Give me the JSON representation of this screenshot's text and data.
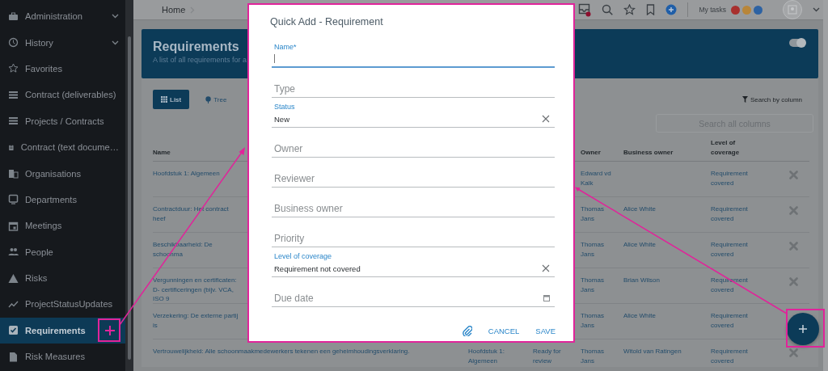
{
  "sidebar": {
    "items": [
      {
        "label": "Administration",
        "expandable": true,
        "selected": false
      },
      {
        "label": "History",
        "expandable": true,
        "selected": false
      },
      {
        "label": "Favorites",
        "expandable": false,
        "selected": false
      },
      {
        "label": "Contract (deliverables)",
        "expandable": false,
        "selected": false
      },
      {
        "label": "Projects / Contracts",
        "expandable": false,
        "selected": false
      },
      {
        "label": "Contract (text docume…",
        "expandable": false,
        "selected": false
      },
      {
        "label": "Organisations",
        "expandable": false,
        "selected": false
      },
      {
        "label": "Departments",
        "expandable": false,
        "selected": false
      },
      {
        "label": "Meetings",
        "expandable": false,
        "selected": false
      },
      {
        "label": "People",
        "expandable": false,
        "selected": false
      },
      {
        "label": "Risks",
        "expandable": false,
        "selected": false
      },
      {
        "label": "ProjectStatusUpdates",
        "expandable": false,
        "selected": false
      },
      {
        "label": "Requirements",
        "expandable": false,
        "selected": true
      },
      {
        "label": "Risk Measures",
        "expandable": false,
        "selected": false
      }
    ]
  },
  "top_bar": {
    "breadcrumb": [
      "Home"
    ],
    "notification": true,
    "tasks_label": "My tasks",
    "task_badges": [
      {
        "color": "#a8302e"
      },
      {
        "color": "#b8863a"
      },
      {
        "color": "#2d62a3"
      }
    ]
  },
  "header": {
    "title": "Requirements",
    "subtitle": "A list of all requirements for a",
    "toggle_on": true
  },
  "views": [
    {
      "label": "List",
      "selected": true
    },
    {
      "label": "Tree",
      "selected": false
    }
  ],
  "search_by_column": "Search by column",
  "search": {
    "placeholder": "Search all columns"
  },
  "table": {
    "columns": [
      "Name",
      "Owner",
      "Business owner",
      "Level of coverage"
    ],
    "rows": [
      {
        "name": "Hoofdstuk 1: Algemeen",
        "owner": "Edward vd Kalk",
        "level_of_coverage": "Requirement covered"
      },
      {
        "name": "Contractduur: Het contract heef",
        "owner": "Thomas Jans",
        "business_owner": "Alice White",
        "level_of_coverage": "Requirement covered"
      },
      {
        "name": "Beschikbaarheid: De schoonma",
        "owner": "Thomas Jans",
        "business_owner": "Alice White",
        "level_of_coverage": "Requirement covered"
      },
      {
        "name": "Vergunningen en certificaten: D- certificeringen (bijv. VCA, ISO 9",
        "owner": "Thomas Jans",
        "business_owner": "Brian Wilson",
        "level_of_coverage": "Requirement covered"
      },
      {
        "name": "Verzekering: De externe partij is",
        "owner": "Thomas Jans",
        "business_owner": "Alice White",
        "level_of_coverage": "Requirement covered"
      },
      {
        "name": "Vertrouwelijkheid: Alle schoonmaakmedewerkers tekenen een geheimhoudingsverklaring.",
        "column_2": "Hoofdstuk 1: Algemeen",
        "column_3": "Ready for review",
        "owner": "Thomas Jans",
        "business_owner": "Witold van Ratingen",
        "level_of_coverage": "Requirement covered"
      }
    ]
  },
  "dialog": {
    "title": "Quick Add - Requirement",
    "fields": [
      {
        "kind": "text",
        "label": "Name*",
        "focused": true
      },
      {
        "kind": "text",
        "placeholder": "Type",
        "focused": false
      },
      {
        "kind": "select",
        "label": "Status",
        "value": "New",
        "focused": false
      },
      {
        "kind": "text",
        "placeholder": "Owner",
        "focused": false
      },
      {
        "kind": "text",
        "placeholder": "Reviewer",
        "focused": false
      },
      {
        "kind": "text",
        "placeholder": "Business owner",
        "focused": false
      },
      {
        "kind": "text",
        "placeholder": "Priority",
        "focused": false
      },
      {
        "kind": "select",
        "label": "Level of coverage",
        "value": "Requirement not covered",
        "focused": false
      },
      {
        "kind": "date",
        "placeholder": "Due date",
        "focused": false
      }
    ],
    "actions": [
      "CANCEL",
      "SAVE"
    ]
  }
}
